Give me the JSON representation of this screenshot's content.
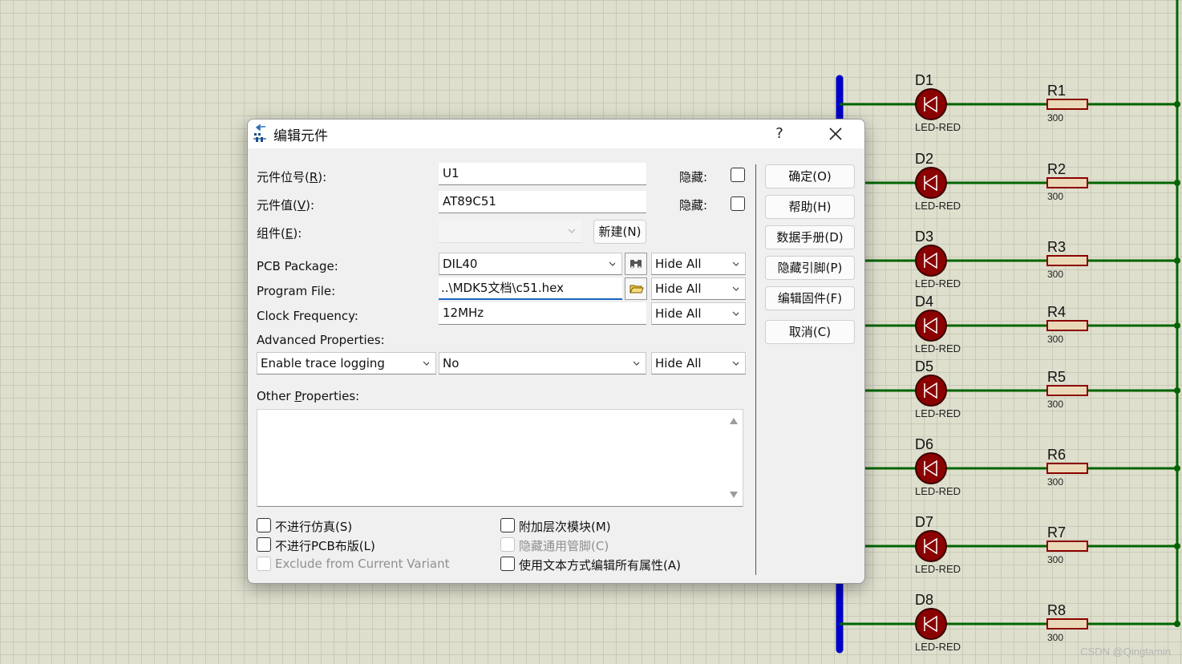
{
  "dialog": {
    "title": "编辑元件",
    "help": "?",
    "labels": {
      "ref_prefix": "元件位号(",
      "ref_key": "R",
      "ref_suffix": "):",
      "val_prefix": "元件值(",
      "val_key": "V",
      "val_suffix": "):",
      "grp_prefix": "组件(",
      "grp_key": "E",
      "grp_suffix": "):",
      "pcb": "PCB Package:",
      "program": "Program File:",
      "clock": "Clock Frequency:",
      "advanced": "Advanced Properties:",
      "other_prefix": "Other ",
      "other_key": "P",
      "other_suffix": "roperties:",
      "hidden": "隐藏:"
    },
    "ref_value": "U1",
    "val_value": "AT89C51",
    "new_button": "新建(N)",
    "pcb_package": "DIL40",
    "program_file": "..\\MDK5文档\\c51.hex",
    "clock_frequency": "12MHz",
    "hide_all": "Hide All",
    "adv_property": "Enable trace logging",
    "adv_value": "No",
    "buttons": [
      "确定(O)",
      "帮助(H)",
      "数据手册(D)",
      "隐藏引脚(P)",
      "编辑固件(F)",
      "取消(C)"
    ],
    "checkboxes": {
      "no_sim": "不进行仿真(S)",
      "no_pcb": "不进行PCB布版(L)",
      "exclude_variant": "Exclude from Current Variant",
      "attach_hier": "附加层次模块(M)",
      "hide_common_pins": "隐藏通用管脚(C)",
      "edit_text": "使用文本方式编辑所有属性(A)"
    }
  },
  "schematic": {
    "leds": [
      "D1",
      "D2",
      "D3",
      "D4",
      "D5",
      "D6",
      "D7",
      "D8"
    ],
    "led_type": "LED-RED",
    "resistors": [
      "R1",
      "R2",
      "R3",
      "R4",
      "R5",
      "R6",
      "R7",
      "R8"
    ],
    "resistor_value": "300",
    "colors": {
      "wire": "#006400",
      "bus": "#0000c8",
      "led": "#8b0000",
      "resistor_fill": "#ead9b8",
      "resistor_edge": "#8b0000"
    }
  },
  "watermark": "CSDN @Qingtamin"
}
